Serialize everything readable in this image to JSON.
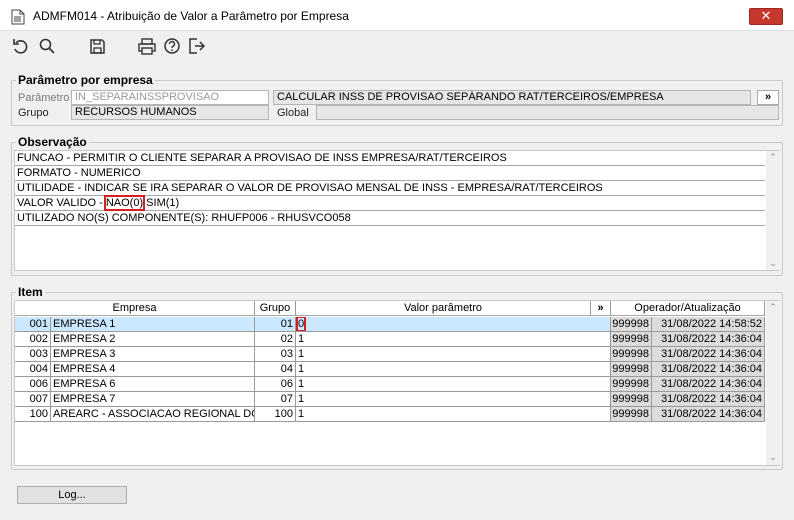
{
  "window": {
    "title": "ADMFM014 - Atribuição de Valor a Parâmetro por Empresa",
    "close_label": "✕"
  },
  "toolbar": {
    "icons": [
      "undo-icon",
      "search-icon",
      "save-icon",
      "print-icon",
      "help-icon",
      "exit-icon"
    ]
  },
  "parametro_group": {
    "legend": "Parâmetro por empresa",
    "parametro_label": "Parâmetro",
    "parametro_value": "IN_SEPARAINSSPROVISAO",
    "parametro_desc": "CALCULAR INSS DE PROVISAO SEPÁRANDO RAT/TERCEIROS/EMPRESA",
    "more_label": "»",
    "grupo_label": "Grupo",
    "grupo_value": "RECURSOS HUMANOS",
    "global_label": "Global",
    "global_value": ""
  },
  "observacao": {
    "legend": "Observação",
    "lines": [
      "FUNCAO - PERMITIR O CLIENTE SEPARAR A PROVISAO DE INSS EMPRESA/RAT/TERCEIROS",
      "FORMATO - NUMERICO",
      "UTILIDADE - INDICAR SE IRA SEPARAR O VALOR DE PROVISAO MENSAL DE INSS - EMPRESA/RAT/TERCEIROS"
    ],
    "valor_prefix": "VALOR VALIDO - ",
    "valor_nao": "NAO(0)",
    "valor_sim": " SIM(1)",
    "componentes": "UTILIZADO NO(S) COMPONENTE(S): RHUFP006 - RHUSVCO058"
  },
  "item": {
    "legend": "Item",
    "headers": {
      "empresa": "Empresa",
      "grupo": "Grupo",
      "valor": "Valor parâmetro",
      "more": "»",
      "operador": "Operador/Atualização"
    },
    "rows": [
      {
        "code": "001",
        "empresa": "EMPRESA 1",
        "grupo": "01",
        "valor": "0",
        "operador": "999998",
        "data": "31/08/2022 14:58:52"
      },
      {
        "code": "002",
        "empresa": "EMPRESA 2",
        "grupo": "02",
        "valor": "1",
        "operador": "999998",
        "data": "31/08/2022 14:36:04"
      },
      {
        "code": "003",
        "empresa": "EMPRESA 3",
        "grupo": "03",
        "valor": "1",
        "operador": "999998",
        "data": "31/08/2022 14:36:04"
      },
      {
        "code": "004",
        "empresa": "EMPRESA 4",
        "grupo": "04",
        "valor": "1",
        "operador": "999998",
        "data": "31/08/2022 14:36:04"
      },
      {
        "code": "006",
        "empresa": "EMPRESA 6",
        "grupo": "06",
        "valor": "1",
        "operador": "999998",
        "data": "31/08/2022 14:36:04"
      },
      {
        "code": "007",
        "empresa": "EMPRESA 7",
        "grupo": "07",
        "valor": "1",
        "operador": "999998",
        "data": "31/08/2022 14:36:04"
      },
      {
        "code": "100",
        "empresa": "AREARC - ASSOCIACAO REGIONAL DOS",
        "grupo": "100",
        "valor": "1",
        "operador": "999998",
        "data": "31/08/2022 14:36:04"
      }
    ]
  },
  "footer": {
    "log_label": "Log..."
  },
  "colors": {
    "highlight": "#d61f1f",
    "selected_row": "#cce8ff",
    "close_button": "#c6382c"
  }
}
